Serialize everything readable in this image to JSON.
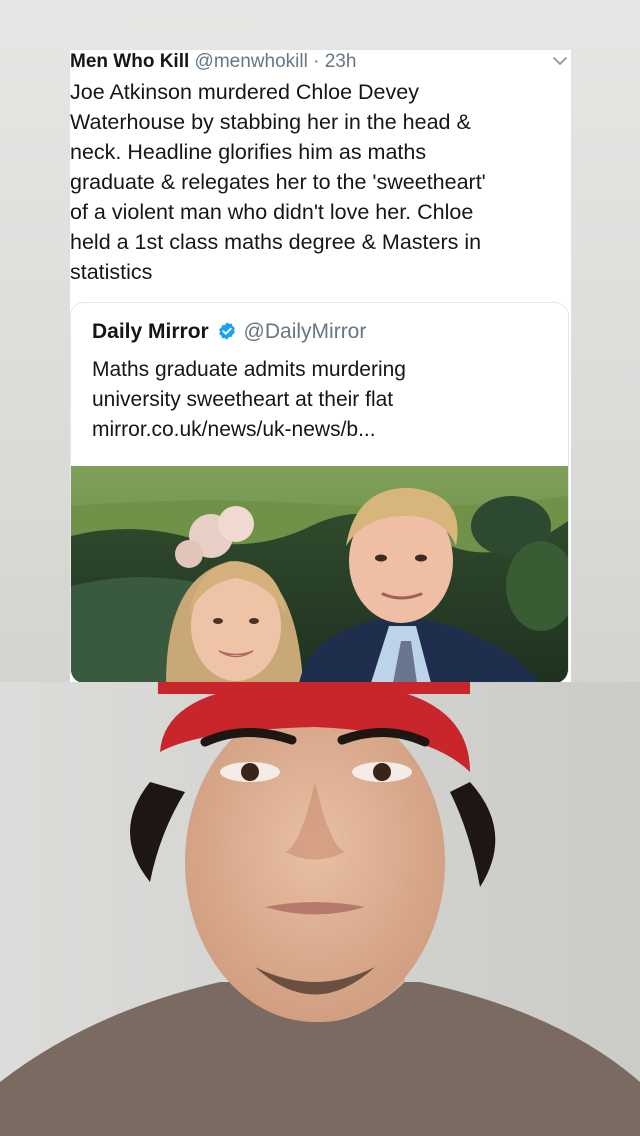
{
  "tweet": {
    "author_name": "Men Who Kill",
    "author_meta": " @menwhokill · 23h",
    "text": "Joe Atkinson murdered Chloe Devey\nWaterhouse by stabbing her in the head &\nneck. Headline glorifies him as maths\ngraduate & relegates her to the 'sweetheart'\nof a violent man who didn't love her. Chloe\nheld a 1st class maths degree & Masters in\nstatistics"
  },
  "quoted_tweet": {
    "author_name": "Daily Mirror",
    "author_handle": "@DailyMirror",
    "text": "Maths graduate admits murdering\nuniversity sweetheart at their flat\nmirror.co.uk/news/uk-news/b..."
  },
  "colors": {
    "text_primary": "#14171a",
    "text_secondary": "#657786",
    "verified_blue": "#1da1f2",
    "beanie_red": "#c8262b"
  },
  "icons": {
    "menu": "chevron-down-icon",
    "verified": "verified-badge-icon"
  }
}
